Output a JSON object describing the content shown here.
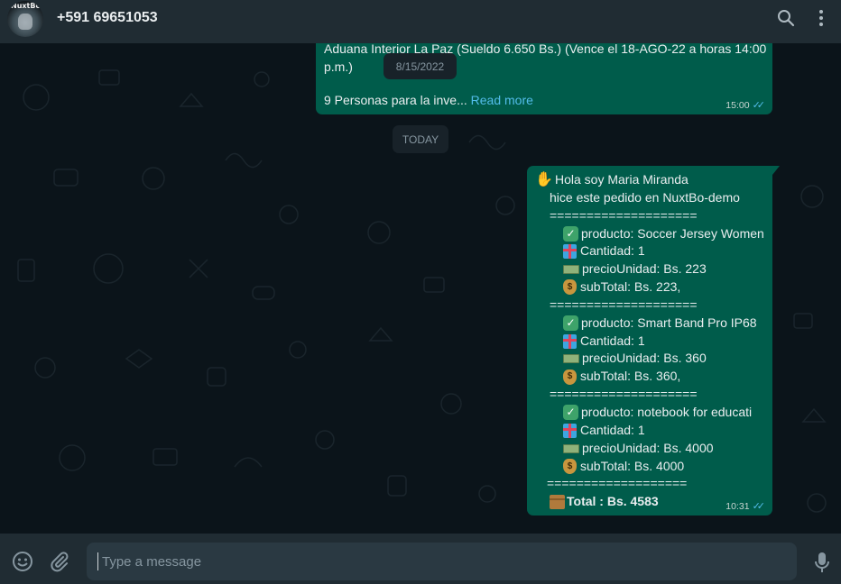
{
  "header": {
    "avatar_text": "NuxtBo",
    "contact_name": "+591 69651053",
    "search_icon": "search-icon",
    "menu_icon": "kebab-menu-icon"
  },
  "chat": {
    "floating_date": "8/15/2022",
    "today_label": "TODAY",
    "message1": {
      "line1": "Aduana Interior La Paz (Sueldo 6.650 Bs.) (Vence el 18-AGO-22 a horas 14:00",
      "line2": "p.m.)",
      "line3_text": "9 Personas para la inve...",
      "read_more": "Read more",
      "time": "15:00",
      "status_icon": "double-check-icon"
    },
    "message2": {
      "greeting": "Hola soy Maria Miranda",
      "intro": "hice este pedido en NuxtBo-demo",
      "separator": "====================",
      "items": [
        {
          "producto": "producto:  Soccer Jersey Women",
          "cantidad": "Cantidad: 1",
          "precio": "precioUnidad: Bs. 223",
          "subtotal": "subTotal: Bs. 223,"
        },
        {
          "producto": "producto: Smart Band Pro IP68",
          "cantidad": "Cantidad: 1",
          "precio": "precioUnidad: Bs. 360",
          "subtotal": "subTotal: Bs. 360,"
        },
        {
          "producto": "producto: notebook for educati",
          "cantidad": "Cantidad: 1",
          "precio": "precioUnidad: Bs. 4000",
          "subtotal": "subTotal: Bs. 4000"
        }
      ],
      "final_separator": "===================",
      "total": "Total : Bs. 4583",
      "time": "10:31",
      "status_icon": "double-check-icon"
    }
  },
  "composer": {
    "emoji_icon": "emoji-icon",
    "attach_icon": "paperclip-icon",
    "placeholder": "Type a message",
    "mic_icon": "microphone-icon"
  },
  "colors": {
    "header_bg": "#202c33",
    "chat_bg": "#0b141a",
    "outgoing_bubble": "#005c4b",
    "link": "#53bdeb",
    "input_bg": "#2a3942"
  }
}
